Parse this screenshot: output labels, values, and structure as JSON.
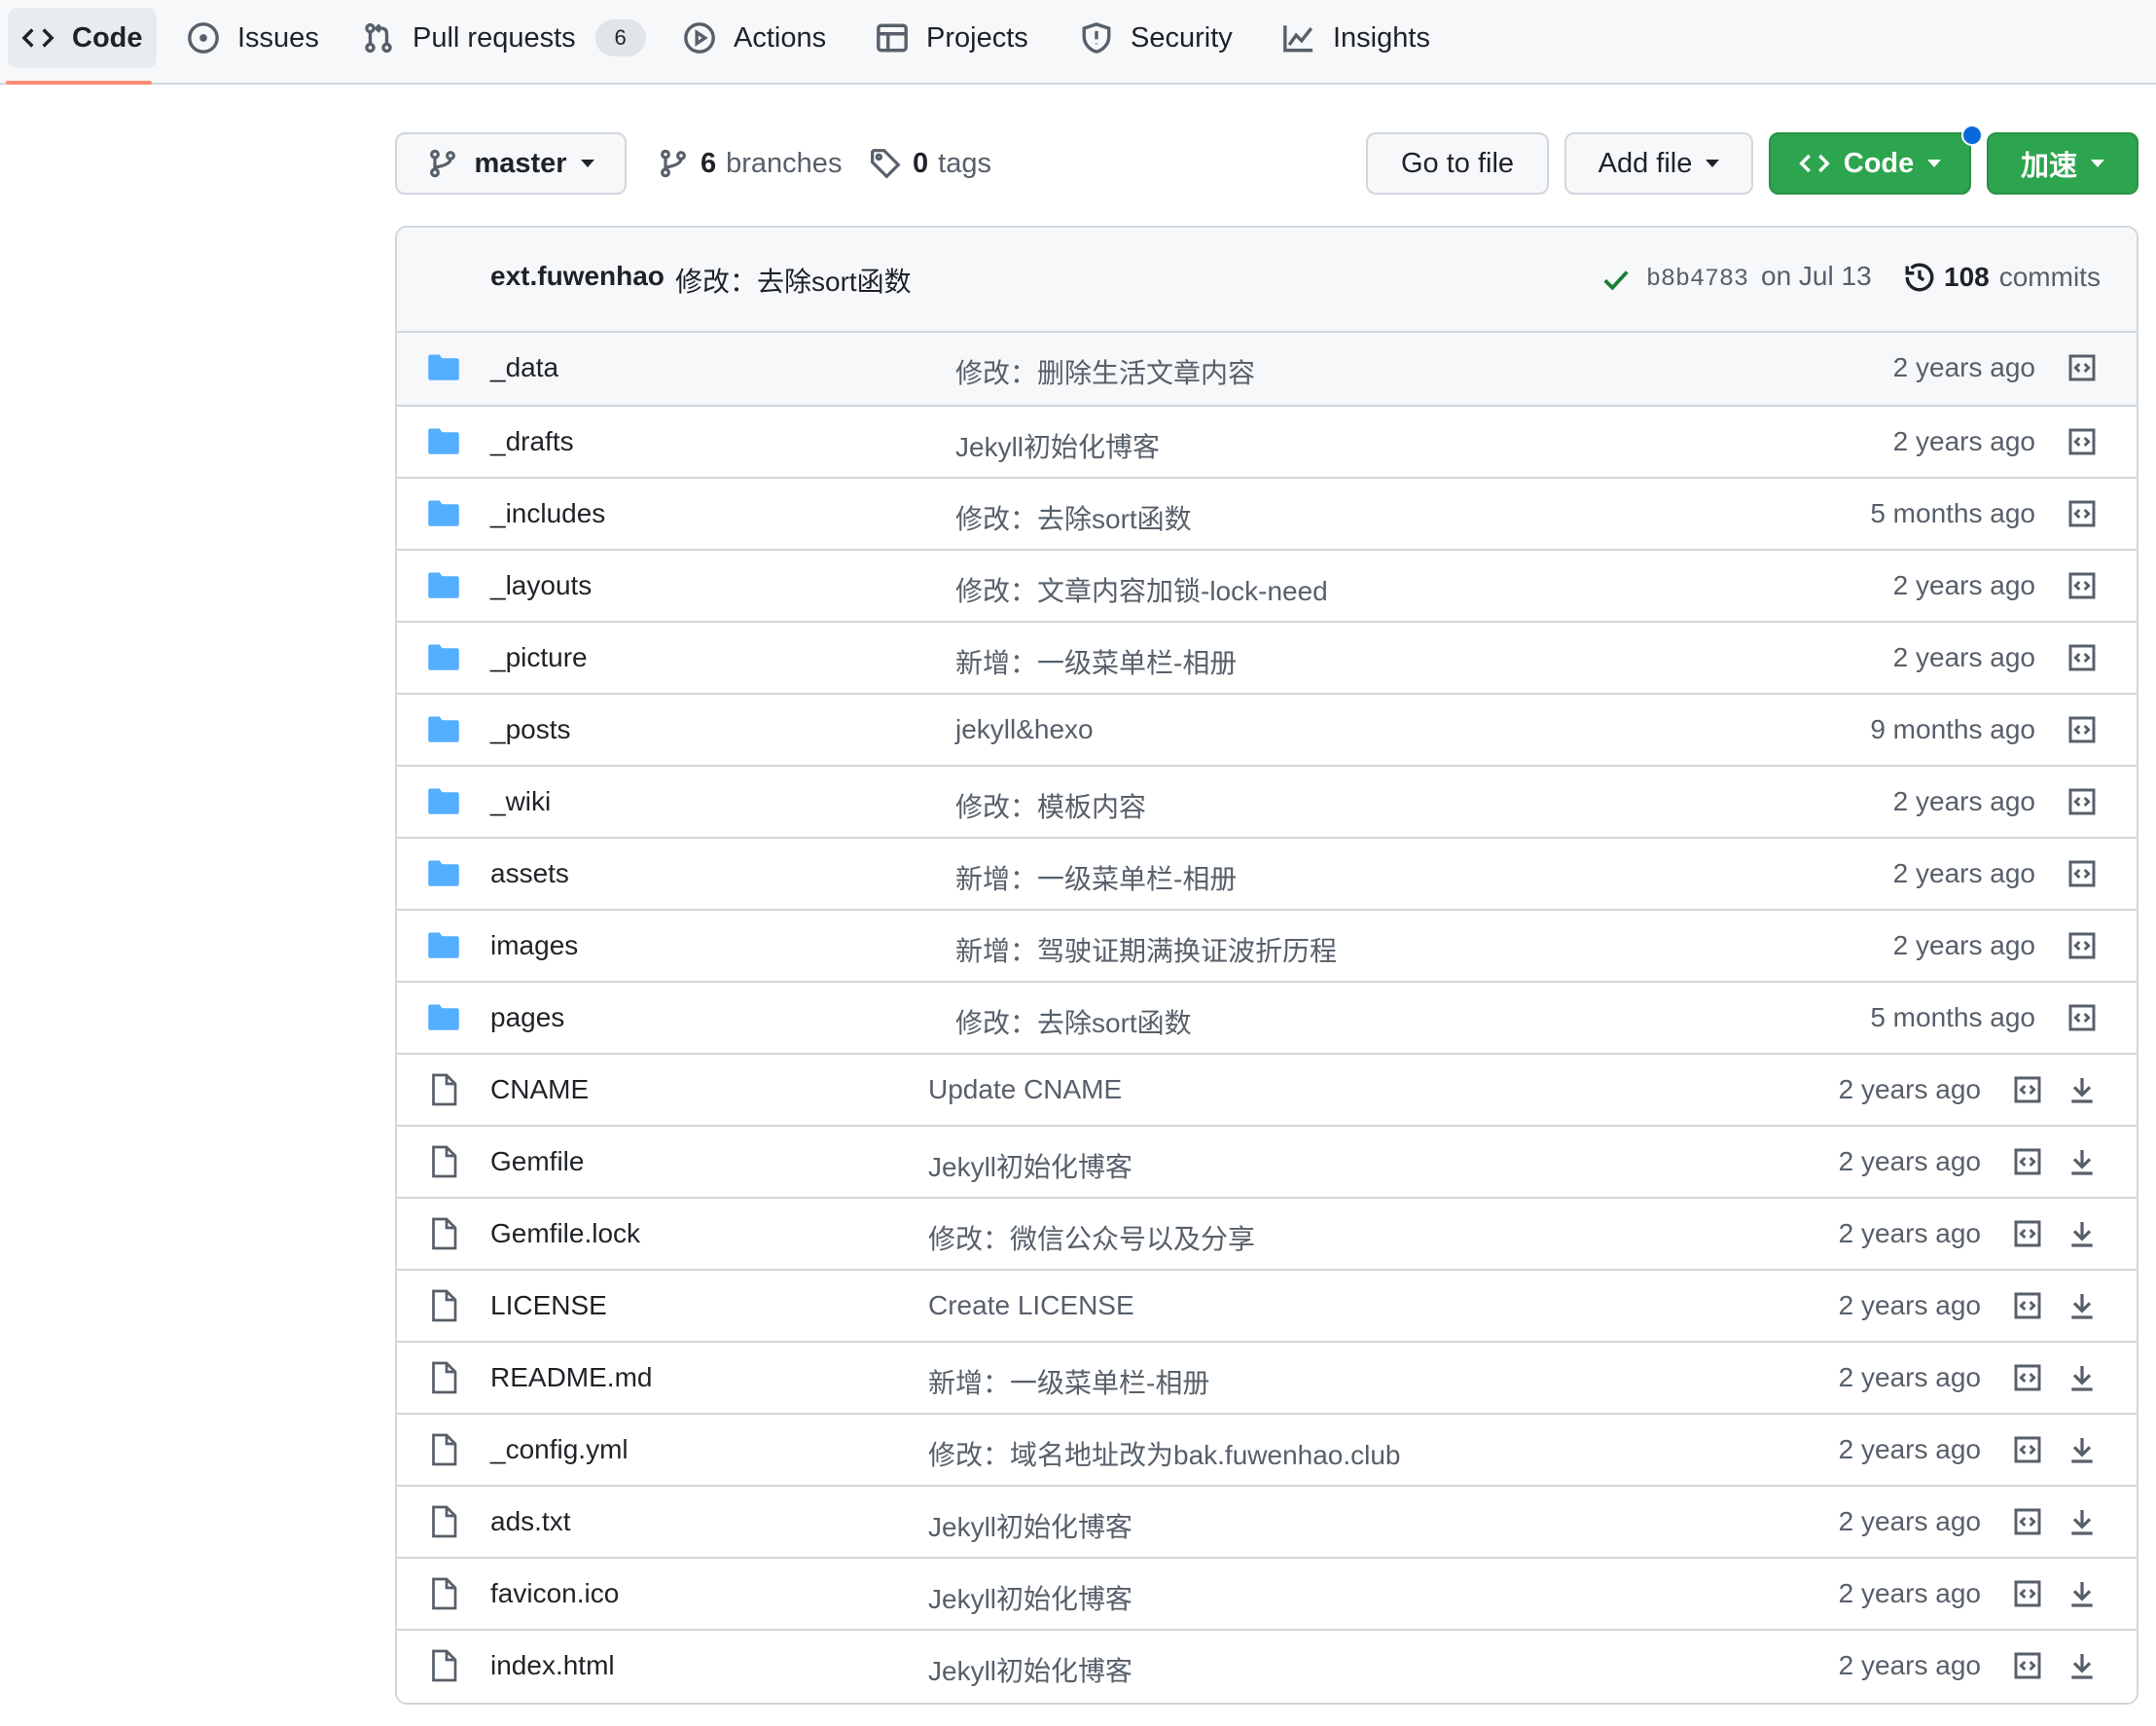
{
  "nav": {
    "tabs": [
      {
        "label": "Code",
        "icon": "code-icon",
        "active": true
      },
      {
        "label": "Issues",
        "icon": "issue-icon"
      },
      {
        "label": "Pull requests",
        "icon": "pull-request-icon",
        "count": "6"
      },
      {
        "label": "Actions",
        "icon": "play-icon"
      },
      {
        "label": "Projects",
        "icon": "table-icon"
      },
      {
        "label": "Security",
        "icon": "shield-icon"
      },
      {
        "label": "Insights",
        "icon": "graph-icon"
      }
    ]
  },
  "toolbar": {
    "branch": "master",
    "branches_count": "6",
    "branches_label": "branches",
    "tags_count": "0",
    "tags_label": "tags",
    "go_to_file": "Go to file",
    "add_file": "Add file",
    "code": "Code",
    "accelerate": "加速"
  },
  "commit": {
    "author": "ext.fuwenhao",
    "message": "修改：去除sort函数",
    "sha": "b8b4783",
    "date": "on Jul 13",
    "count": "108",
    "count_label": "commits"
  },
  "files": [
    {
      "name": "_data",
      "type": "dir",
      "message": "修改：删除生活文章内容",
      "age": "2 years ago"
    },
    {
      "name": "_drafts",
      "type": "dir",
      "message": "Jekyll初始化博客",
      "age": "2 years ago"
    },
    {
      "name": "_includes",
      "type": "dir",
      "message": "修改：去除sort函数",
      "age": "5 months ago"
    },
    {
      "name": "_layouts",
      "type": "dir",
      "message": "修改：文章内容加锁-lock-need",
      "age": "2 years ago"
    },
    {
      "name": "_picture",
      "type": "dir",
      "message": "新增：一级菜单栏-相册",
      "age": "2 years ago"
    },
    {
      "name": "_posts",
      "type": "dir",
      "message": "jekyll&hexo",
      "age": "9 months ago"
    },
    {
      "name": "_wiki",
      "type": "dir",
      "message": "修改：模板内容",
      "age": "2 years ago"
    },
    {
      "name": "assets",
      "type": "dir",
      "message": "新增：一级菜单栏-相册",
      "age": "2 years ago"
    },
    {
      "name": "images",
      "type": "dir",
      "message": "新增：驾驶证期满换证波折历程",
      "age": "2 years ago"
    },
    {
      "name": "pages",
      "type": "dir",
      "message": "修改：去除sort函数",
      "age": "5 months ago"
    },
    {
      "name": "CNAME",
      "type": "file",
      "message": "Update CNAME",
      "age": "2 years ago"
    },
    {
      "name": "Gemfile",
      "type": "file",
      "message": "Jekyll初始化博客",
      "age": "2 years ago"
    },
    {
      "name": "Gemfile.lock",
      "type": "file",
      "message": "修改：微信公众号以及分享",
      "age": "2 years ago"
    },
    {
      "name": "LICENSE",
      "type": "file",
      "message": "Create LICENSE",
      "age": "2 years ago"
    },
    {
      "name": "README.md",
      "type": "file",
      "message": "新增：一级菜单栏-相册",
      "age": "2 years ago"
    },
    {
      "name": "_config.yml",
      "type": "file",
      "message": "修改：域名地址改为bak.fuwenhao.club",
      "age": "2 years ago"
    },
    {
      "name": "ads.txt",
      "type": "file",
      "message": "Jekyll初始化博客",
      "age": "2 years ago"
    },
    {
      "name": "favicon.ico",
      "type": "file",
      "message": "Jekyll初始化博客",
      "age": "2 years ago"
    },
    {
      "name": "index.html",
      "type": "file",
      "message": "Jekyll初始化博客",
      "age": "2 years ago"
    }
  ],
  "colors": {
    "accent_green": "#2da44e",
    "folder_blue": "#54aeff",
    "tab_underline": "#fd8c73",
    "notification_dot": "#0969da"
  }
}
